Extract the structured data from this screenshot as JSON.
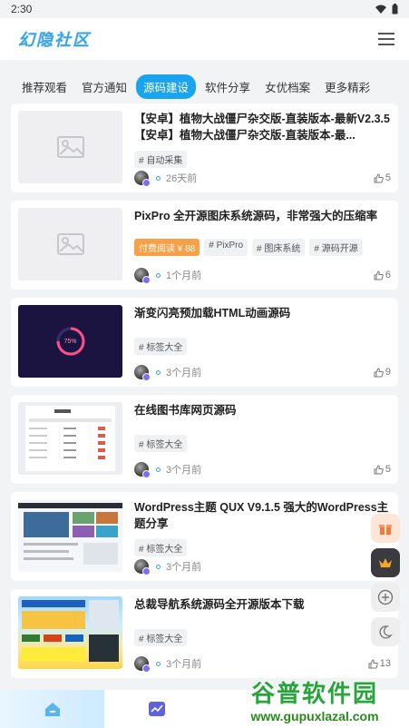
{
  "status": {
    "time": "2:30"
  },
  "header": {
    "logo_text": "幻隐社区"
  },
  "tabs": [
    {
      "label": "推荐观看",
      "active": false
    },
    {
      "label": "官方通知",
      "active": false
    },
    {
      "label": "源码建设",
      "active": true
    },
    {
      "label": "软件分享",
      "active": false
    },
    {
      "label": "女优档案",
      "active": false
    },
    {
      "label": "更多精彩",
      "active": false
    }
  ],
  "posts": [
    {
      "title": "【安卓】植物大战僵尸杂交版-直装版本-最新V2.3.5【安卓】植物大战僵尸杂交版-直装版本-最...",
      "tags": [
        "# 自动采集"
      ],
      "paid": null,
      "time": "26天前",
      "likes": "5",
      "thumb": "placeholder"
    },
    {
      "title": "PixPro 全开源图床系统源码，非常强大的压缩率",
      "tags": [
        "# PixPro",
        "# 图床系统",
        "# 源码开源"
      ],
      "paid": "付费阅读 ¥ 88",
      "time": "1个月前",
      "likes": "6",
      "thumb": "placeholder"
    },
    {
      "title": "渐变闪亮预加载HTML动画源码",
      "tags": [
        "# 标签大全"
      ],
      "paid": null,
      "time": "3个月前",
      "likes": "9",
      "thumb": "dark",
      "thumb_text": "75%"
    },
    {
      "title": "在线图书库网页源码",
      "tags": [
        "# 标签大全"
      ],
      "paid": null,
      "time": "3个月前",
      "likes": "5",
      "thumb": "light"
    },
    {
      "title": "WordPress主题 QUX V9.1.5 强大的WordPress主题分享",
      "tags": [
        "# 标签大全"
      ],
      "paid": null,
      "time": "3个月前",
      "likes": "",
      "thumb": "web"
    },
    {
      "title": "总裁导航系统源码全开源版本下载",
      "tags": [
        "# 标签大全"
      ],
      "paid": null,
      "time": "3个月前",
      "likes": "13",
      "thumb": "colorful"
    }
  ],
  "watermark": {
    "title": "谷普软件园",
    "url": "www.gupuxlazal.com"
  }
}
